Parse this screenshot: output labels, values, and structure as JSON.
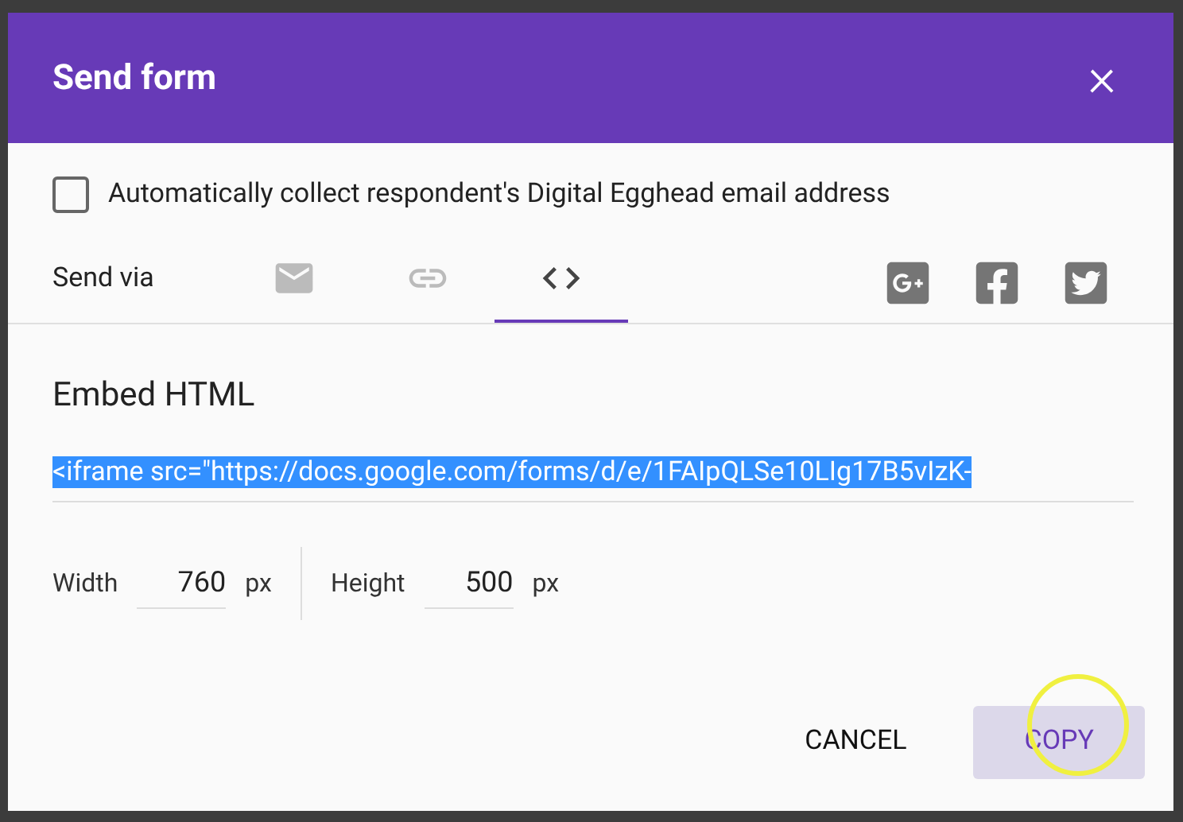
{
  "dialog": {
    "title": "Send form",
    "close": "×"
  },
  "collect_email": {
    "label": "Automatically collect respondent's Digital Egghead email address",
    "checked": false
  },
  "send_via": {
    "label": "Send via",
    "tabs": [
      {
        "kind": "email",
        "selected": false
      },
      {
        "kind": "link",
        "selected": false
      },
      {
        "kind": "embed",
        "selected": true
      }
    ],
    "share": [
      {
        "kind": "googleplus"
      },
      {
        "kind": "facebook"
      },
      {
        "kind": "twitter"
      }
    ]
  },
  "embed": {
    "heading": "Embed HTML",
    "code": "<iframe src=\"https://docs.google.com/forms/d/e/1FAIpQLSe10LIg17B5vIzK-",
    "highlighted": true,
    "width": {
      "label": "Width",
      "value": "760",
      "unit": "px"
    },
    "height": {
      "label": "Height",
      "value": "500",
      "unit": "px"
    }
  },
  "buttons": [
    {
      "label": "CANCEL",
      "kind": "text"
    },
    {
      "label": "COPY",
      "kind": "primary"
    }
  ]
}
